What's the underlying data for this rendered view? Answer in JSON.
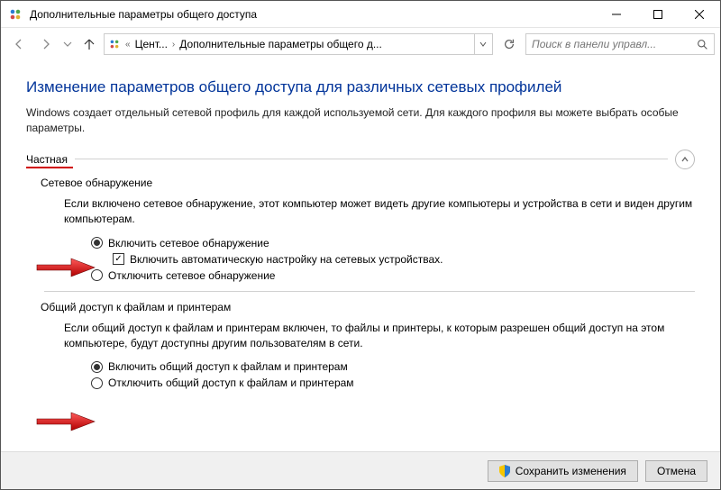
{
  "window": {
    "title": "Дополнительные параметры общего доступа"
  },
  "breadcrumb": {
    "seg1": "Цент...",
    "seg2": "Дополнительные параметры общего д..."
  },
  "search": {
    "placeholder": "Поиск в панели управл..."
  },
  "page": {
    "title": "Изменение параметров общего доступа для различных сетевых профилей",
    "desc": "Windows создает отдельный сетевой профиль для каждой используемой сети. Для каждого профиля вы можете выбрать особые параметры."
  },
  "section_private": {
    "label": "Частная"
  },
  "discovery": {
    "title": "Сетевое обнаружение",
    "desc": "Если включено сетевое обнаружение, этот компьютер может видеть другие компьютеры и устройства в сети и виден другим компьютерам.",
    "opt_on": "Включить сетевое обнаружение",
    "opt_auto": "Включить автоматическую настройку на сетевых устройствах.",
    "opt_off": "Отключить сетевое обнаружение"
  },
  "fileshare": {
    "title": "Общий доступ к файлам и принтерам",
    "desc": "Если общий доступ к файлам и принтерам включен, то файлы и принтеры, к которым разрешен общий доступ на этом компьютере, будут доступны другим пользователям в сети.",
    "opt_on": "Включить общий доступ к файлам и принтерам",
    "opt_off": "Отключить общий доступ к файлам и принтерам"
  },
  "footer": {
    "save": "Сохранить изменения",
    "cancel": "Отмена"
  }
}
